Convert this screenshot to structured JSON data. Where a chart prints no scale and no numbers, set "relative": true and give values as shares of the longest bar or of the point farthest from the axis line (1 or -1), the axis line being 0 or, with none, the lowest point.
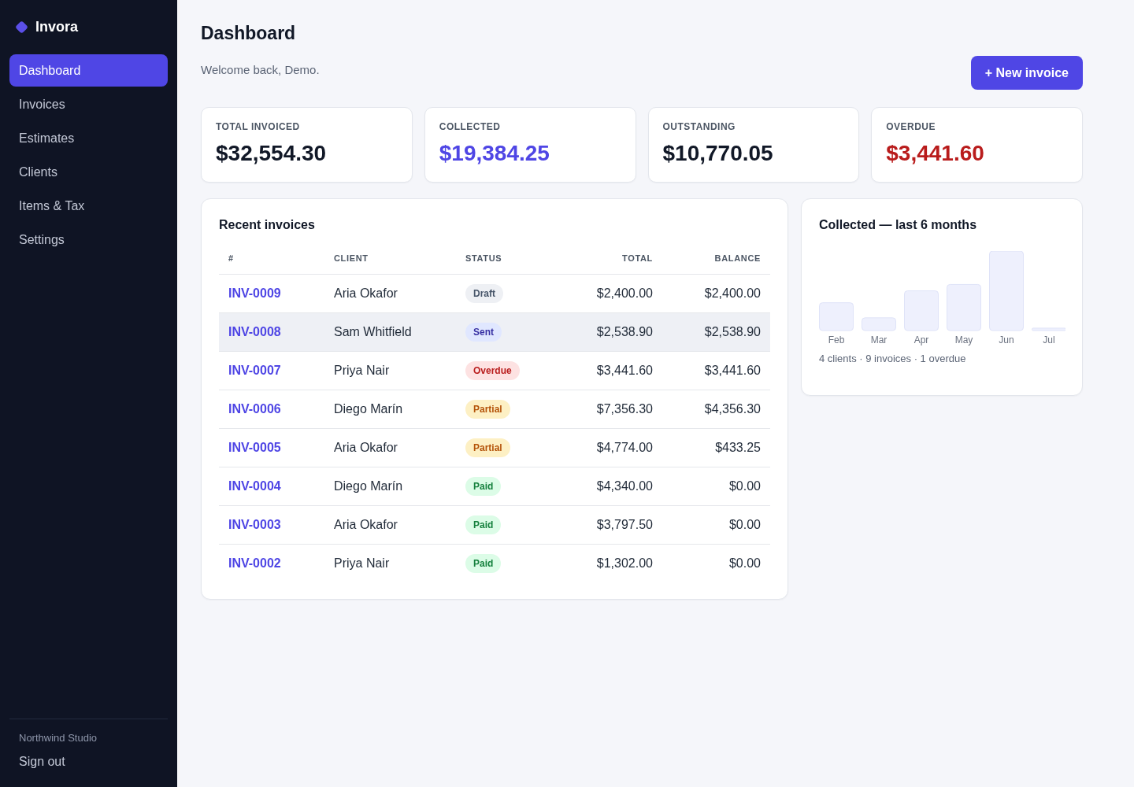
{
  "sidebar": {
    "brand": "Invora",
    "items": [
      {
        "label": "Dashboard",
        "selected": true
      },
      {
        "label": "Invoices",
        "selected": false
      },
      {
        "label": "Estimates",
        "selected": false
      },
      {
        "label": "Clients",
        "selected": false
      },
      {
        "label": "Items & Tax",
        "selected": false
      },
      {
        "label": "Settings",
        "selected": false
      }
    ],
    "workspace": "Northwind Studio",
    "sign_out": "Sign out"
  },
  "header": {
    "title": "Dashboard",
    "subtitle": "Welcome back, Demo.",
    "action": "+ New invoice"
  },
  "stats": [
    {
      "label": "TOTAL INVOICED",
      "value": "$32,554.30",
      "kind": "neutral"
    },
    {
      "label": "COLLECTED",
      "value": "$19,384.25",
      "kind": "accent"
    },
    {
      "label": "OUTSTANDING",
      "value": "$10,770.05",
      "kind": "neutral"
    },
    {
      "label": "OVERDUE",
      "value": "$3,441.60",
      "kind": "danger"
    }
  ],
  "recent_invoices": {
    "title": "Recent invoices",
    "columns": [
      "#",
      "CLIENT",
      "STATUS",
      "TOTAL",
      "BALANCE"
    ],
    "rows": [
      {
        "number": "INV-0009",
        "client": "Aria Okafor",
        "status": {
          "label": "Draft",
          "kind": "draft"
        },
        "total": "$2,400.00",
        "balance": "$2,400.00",
        "selected": false
      },
      {
        "number": "INV-0008",
        "client": "Sam Whitfield",
        "status": {
          "label": "Sent",
          "kind": "sent"
        },
        "total": "$2,538.90",
        "balance": "$2,538.90",
        "selected": true
      },
      {
        "number": "INV-0007",
        "client": "Priya Nair",
        "status": {
          "label": "Overdue",
          "kind": "overdue"
        },
        "total": "$3,441.60",
        "balance": "$3,441.60",
        "selected": false
      },
      {
        "number": "INV-0006",
        "client": "Diego Marín",
        "status": {
          "label": "Partial",
          "kind": "partial"
        },
        "total": "$7,356.30",
        "balance": "$4,356.30",
        "selected": false
      },
      {
        "number": "INV-0005",
        "client": "Aria Okafor",
        "status": {
          "label": "Partial",
          "kind": "partial"
        },
        "total": "$4,774.00",
        "balance": "$433.25",
        "selected": false
      },
      {
        "number": "INV-0004",
        "client": "Diego Marín",
        "status": {
          "label": "Paid",
          "kind": "paid"
        },
        "total": "$4,340.00",
        "balance": "$0.00",
        "selected": false
      },
      {
        "number": "INV-0003",
        "client": "Aria Okafor",
        "status": {
          "label": "Paid",
          "kind": "paid"
        },
        "total": "$3,797.50",
        "balance": "$0.00",
        "selected": false
      },
      {
        "number": "INV-0002",
        "client": "Priya Nair",
        "status": {
          "label": "Paid",
          "kind": "paid"
        },
        "total": "$1,302.00",
        "balance": "$0.00",
        "selected": false
      }
    ]
  },
  "collected": {
    "chart_data": {
      "type": "bar",
      "relative": true,
      "title": "Collected — last 6 months",
      "categories": [
        "Feb",
        "Mar",
        "Apr",
        "May",
        "Jun",
        "Jul"
      ],
      "values": [
        0.35,
        0.16,
        0.5,
        0.58,
        1.0,
        0.03
      ]
    },
    "summary": "4 clients · 9 invoices · 1 overdue"
  }
}
